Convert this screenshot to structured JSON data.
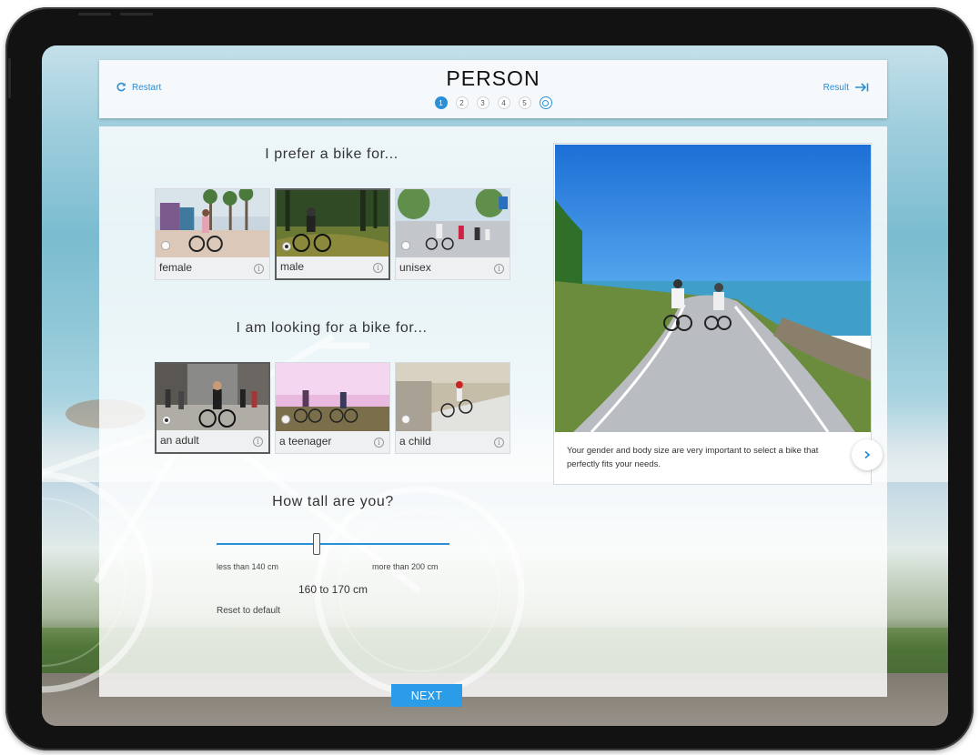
{
  "header": {
    "restart_label": "Restart",
    "restart_icon": "refresh-icon",
    "title": "PERSON",
    "result_label": "Result",
    "result_icon": "arrow-to-end-icon",
    "steps": [
      "1",
      "2",
      "3",
      "4",
      "5",
      ""
    ],
    "active_step": 1
  },
  "gender": {
    "question": "I prefer a bike for...",
    "options": [
      {
        "label": "female",
        "selected": false
      },
      {
        "label": "male",
        "selected": true
      },
      {
        "label": "unisex",
        "selected": false
      }
    ]
  },
  "age": {
    "question": "I am looking for a bike for...",
    "options": [
      {
        "label": "an adult",
        "selected": true
      },
      {
        "label": "a teenager",
        "selected": false
      },
      {
        "label": "a child",
        "selected": false
      }
    ]
  },
  "height": {
    "question": "How tall are you?",
    "min_label": "less than 140 cm",
    "max_label": "more than 200 cm",
    "value_label": "160 to 170 cm",
    "reset_label": "Reset to default"
  },
  "info": {
    "text": "Your gender and body size are very important to select a bike that perfectly fits your needs.",
    "next_icon": "chevron-right-icon"
  },
  "next_button": "NEXT",
  "colors": {
    "accent": "#2a8fd6",
    "button": "#2a9ce8"
  }
}
